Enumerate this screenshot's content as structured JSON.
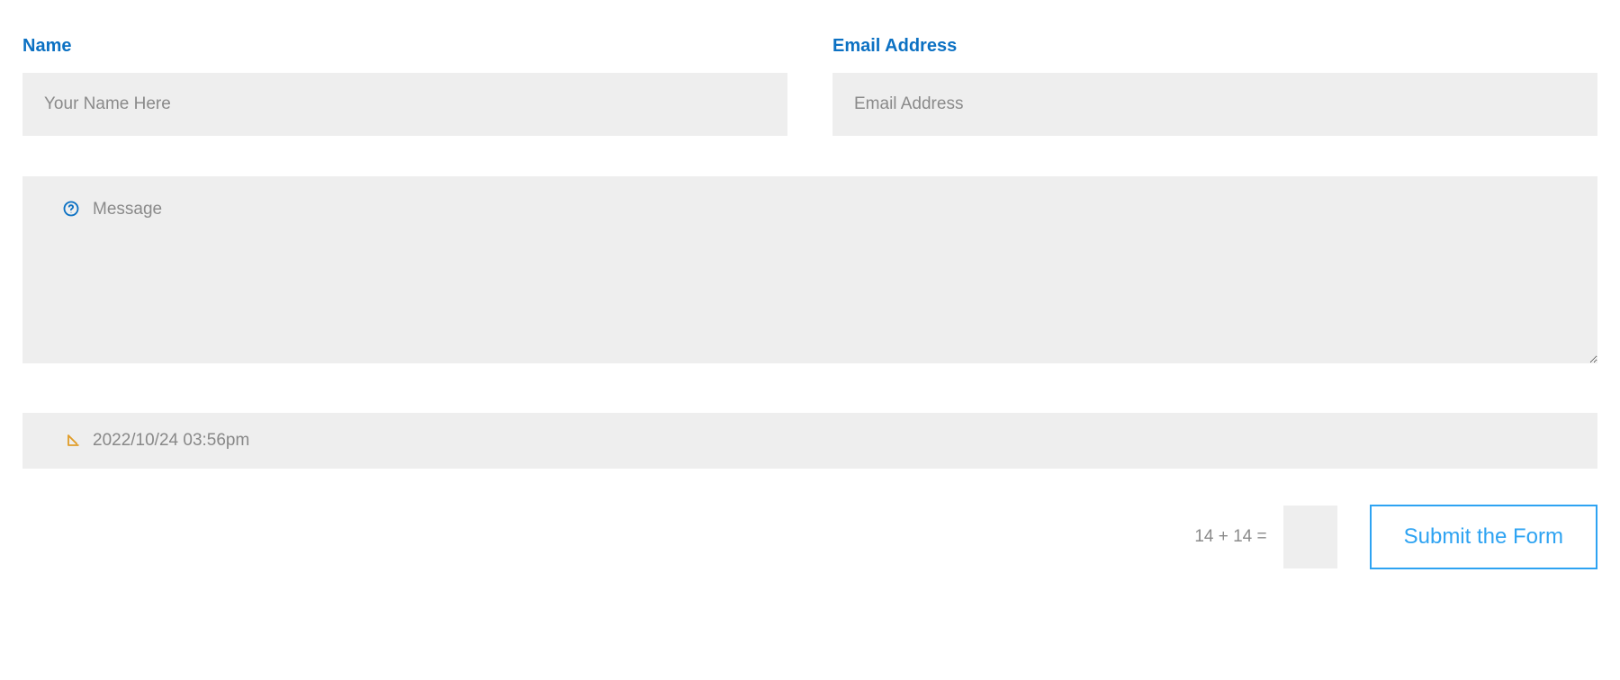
{
  "form": {
    "name": {
      "label": "Name",
      "placeholder": "Your Name Here",
      "value": ""
    },
    "email": {
      "label": "Email Address",
      "placeholder": "Email Address",
      "value": ""
    },
    "message": {
      "placeholder": "Message",
      "value": ""
    },
    "datetime": {
      "value": "2022/10/24 03:56pm"
    },
    "captcha": {
      "question": "14 + 14 =",
      "value": ""
    },
    "submit": {
      "label": "Submit the Form"
    }
  }
}
